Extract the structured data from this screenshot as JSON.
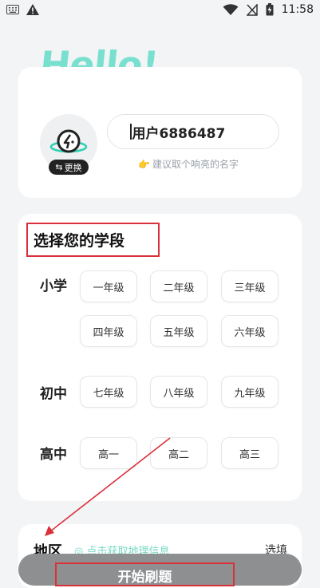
{
  "status_bar": {
    "time": "11:58"
  },
  "header": {
    "greeting": "Hello!"
  },
  "profile": {
    "change_avatar_label": "更换",
    "username": "用户6886487",
    "hint_emoji": "👉",
    "hint": "建议取个响亮的名字"
  },
  "grade": {
    "title": "选择您的学段",
    "levels": [
      {
        "label": "小学",
        "grades": [
          "一年级",
          "二年级",
          "三年级",
          "四年级",
          "五年级",
          "六年级"
        ]
      },
      {
        "label": "初中",
        "grades": [
          "七年级",
          "八年级",
          "九年级"
        ]
      },
      {
        "label": "高中",
        "grades": [
          "高一",
          "高二",
          "高三"
        ]
      }
    ]
  },
  "region": {
    "label": "地区",
    "link": "点击获取地理信息",
    "select": "选填"
  },
  "start": {
    "label": "开始刷题"
  },
  "colors": {
    "accent": "#79e0cf",
    "highlight": "#d9303a"
  }
}
